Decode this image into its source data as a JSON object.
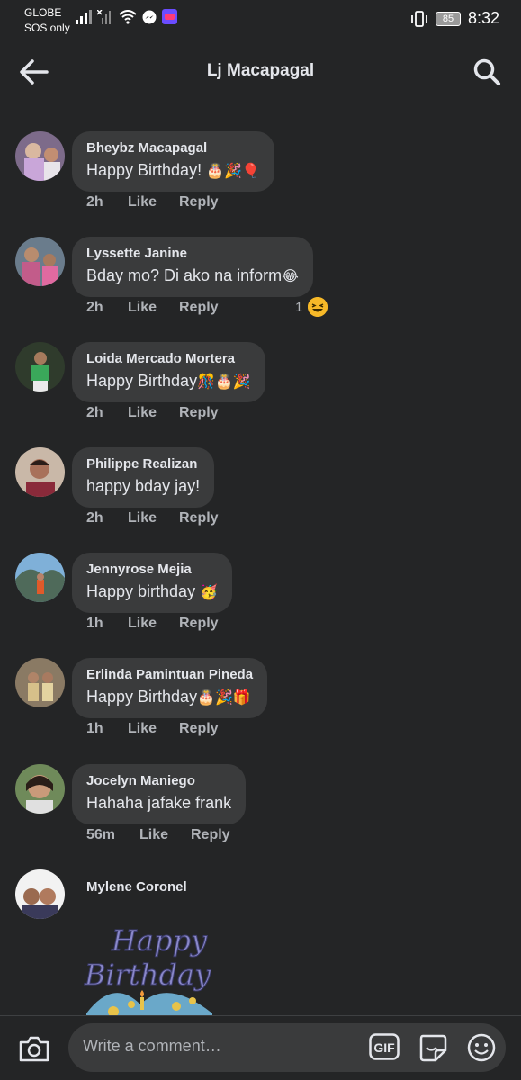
{
  "status_bar": {
    "carrier_line1": "GLOBE",
    "carrier_line2": "SOS only",
    "battery": "85",
    "time": "8:32"
  },
  "header": {
    "title": "Lj Macapagal",
    "back_icon": "back-arrow-icon",
    "search_icon": "search-icon"
  },
  "comments": [
    {
      "author": "Bheybz Macapagal",
      "text": "Happy Birthday! ",
      "emojis": "🎂🎉🎈",
      "time": "2h",
      "like": "Like",
      "reply": "Reply"
    },
    {
      "author": "Lyssette Janine",
      "text": "Bday mo? Di ako na inform",
      "emojis": "😂",
      "time": "2h",
      "like": "Like",
      "reply": "Reply",
      "reaction_count": "1"
    },
    {
      "author": "Loida Mercado Mortera",
      "text": "Happy Birthday",
      "emojis": "🎊🎂🎉",
      "time": "2h",
      "like": "Like",
      "reply": "Reply"
    },
    {
      "author": "Philippe Realizan",
      "text": "happy bday jay!",
      "emojis": "",
      "time": "2h",
      "like": "Like",
      "reply": "Reply"
    },
    {
      "author": "Jennyrose Mejia",
      "text": "Happy birthday ",
      "emojis": "🥳",
      "time": "1h",
      "like": "Like",
      "reply": "Reply"
    },
    {
      "author": "Erlinda Pamintuan Pineda",
      "text": "Happy Birthday",
      "emojis": "🎂🎉🎁",
      "time": "1h",
      "like": "Like",
      "reply": "Reply"
    },
    {
      "author": "Jocelyn Maniego",
      "text": "Hahaha jafake frank",
      "emojis": "",
      "time": "56m",
      "like": "Like",
      "reply": "Reply"
    }
  ],
  "last_comment": {
    "author": "Mylene Coronel",
    "sticker_text_1": "Happy",
    "sticker_text_2": "Birthday"
  },
  "composer": {
    "placeholder": "Write a comment…",
    "gif_label": "GIF"
  },
  "colors": {
    "background": "#242526",
    "bubble": "#3a3b3c",
    "text": "#e4e6eb",
    "muted": "#b0b3b8"
  }
}
